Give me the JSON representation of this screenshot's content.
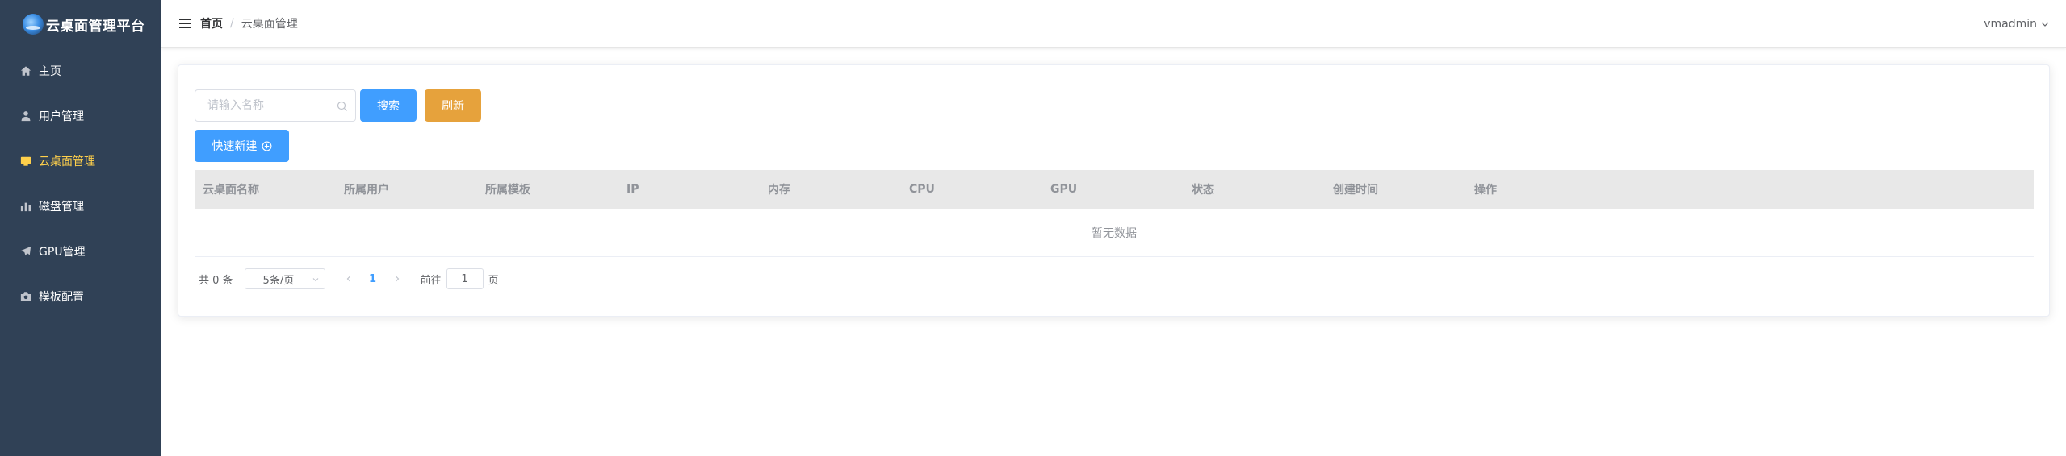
{
  "app": {
    "title": "云桌面管理平台"
  },
  "sidebar": {
    "items": [
      {
        "label": "主页",
        "icon": "home-icon",
        "active": false
      },
      {
        "label": "用户管理",
        "icon": "user-icon",
        "active": false
      },
      {
        "label": "云桌面管理",
        "icon": "monitor-icon",
        "active": true
      },
      {
        "label": "磁盘管理",
        "icon": "bar-chart-icon",
        "active": false
      },
      {
        "label": "GPU管理",
        "icon": "paper-plane-icon",
        "active": false
      },
      {
        "label": "模板配置",
        "icon": "camera-icon",
        "active": false
      }
    ],
    "bg_color": "#304156",
    "active_color": "#ffd04b"
  },
  "header": {
    "breadcrumb": {
      "home": "首页",
      "separator": "/",
      "current": "云桌面管理"
    },
    "user": {
      "name": "vmadmin"
    }
  },
  "toolbar": {
    "search_placeholder": "请输入名称",
    "search_label": "搜索",
    "refresh_label": "刷新",
    "quick_new_label": "快速新建"
  },
  "table": {
    "columns": [
      "云桌面名称",
      "所属用户",
      "所属模板",
      "IP",
      "内存",
      "CPU",
      "GPU",
      "状态",
      "创建时间",
      "操作"
    ],
    "rows": [],
    "empty_text": "暂无数据"
  },
  "pagination": {
    "total_text": "共 0 条",
    "page_size": "5条/页",
    "current_page": "1",
    "goto_prefix": "前往",
    "goto_value": "1",
    "goto_suffix": "页"
  },
  "colors": {
    "primary": "#409eff",
    "warning": "#e6a23c"
  }
}
